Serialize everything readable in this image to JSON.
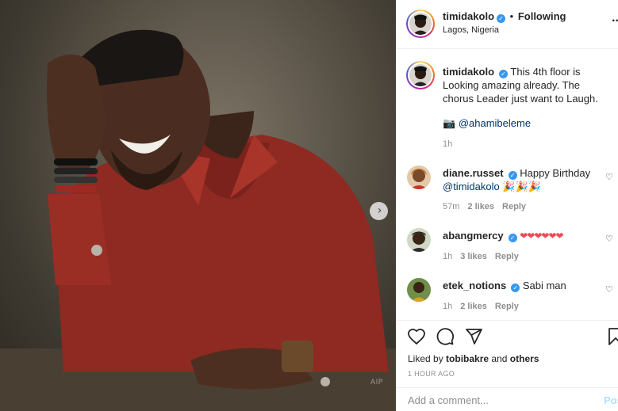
{
  "post": {
    "photo_watermark": "AIP",
    "next_icon": "chevron-right-icon"
  },
  "header": {
    "username": "timidakolo",
    "follow_status": "Following",
    "location": "Lagos, Nigeria",
    "more_icon": "ellipsis-icon"
  },
  "caption": {
    "username": "timidakolo",
    "text": "This 4th floor is Looking amazing already. The chorus Leader just want to Laugh.",
    "credit_prefix": "📷",
    "credit_mention": "@ahamibeleme",
    "time": "1h"
  },
  "comments": [
    {
      "username": "diane.russet",
      "verified": true,
      "text": "Happy Birthday",
      "mention": "@timidakolo",
      "suffix": "🎉🎉🎉",
      "time": "57m",
      "likes": "2 likes",
      "reply": "Reply"
    },
    {
      "username": "abangmercy",
      "verified": true,
      "text": "❤❤❤❤❤❤",
      "time": "1h",
      "likes": "3 likes",
      "reply": "Reply"
    },
    {
      "username": "etek_notions",
      "verified": true,
      "text": "Sabi man",
      "time": "1h",
      "likes": "2 likes",
      "reply": "Reply"
    }
  ],
  "actions": {
    "like_icon": "heart-icon",
    "comment_icon": "comment-icon",
    "share_icon": "share-icon",
    "save_icon": "bookmark-icon",
    "liked_by_prefix": "Liked by",
    "liked_by_user": "tobibakre",
    "liked_by_and": "and",
    "liked_by_others": "others",
    "timestamp": "1 HOUR AGO"
  },
  "add_comment": {
    "placeholder": "Add a comment...",
    "post_label": "Post"
  },
  "colors": {
    "accent": "#3897f0",
    "mention": "#00376b",
    "muted": "#8e8e8e",
    "heart_red": "#ed4956",
    "post_disabled": "#b2dffc"
  }
}
